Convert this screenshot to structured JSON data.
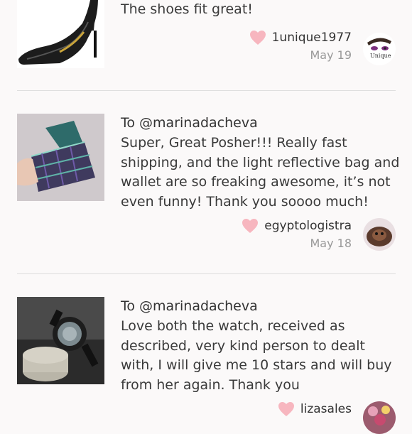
{
  "reviews": [
    {
      "to": "",
      "text": "The shoes fit great!",
      "username": "1unique1977",
      "date": "May 19",
      "image": "black-pump-shoe",
      "avatar": "the-unique-logo"
    },
    {
      "to": "To @marinadacheva",
      "text": "Super, Great Posher!!! Really fast shipping, and the light reflective bag and wallet are so freaking awesome, it’s not even funny! Thank you soooo much!",
      "username": "egyptologistra",
      "date": "May 18",
      "image": "holographic-bag-wallet",
      "avatar": "dog-photo"
    },
    {
      "to": "To @marinadacheva",
      "text": "Love both the watch, received as described, very kind person to dealt with, I will give me 10 stars and will buy from her again. Thank you",
      "username": "lizasales",
      "date": "",
      "image": "black-wristwatch",
      "avatar": "flowers-photo"
    }
  ],
  "colors": {
    "heart": "#f7b6bf",
    "divider": "#dedede",
    "date": "#999999"
  },
  "icons": {
    "like": "heart-icon"
  }
}
